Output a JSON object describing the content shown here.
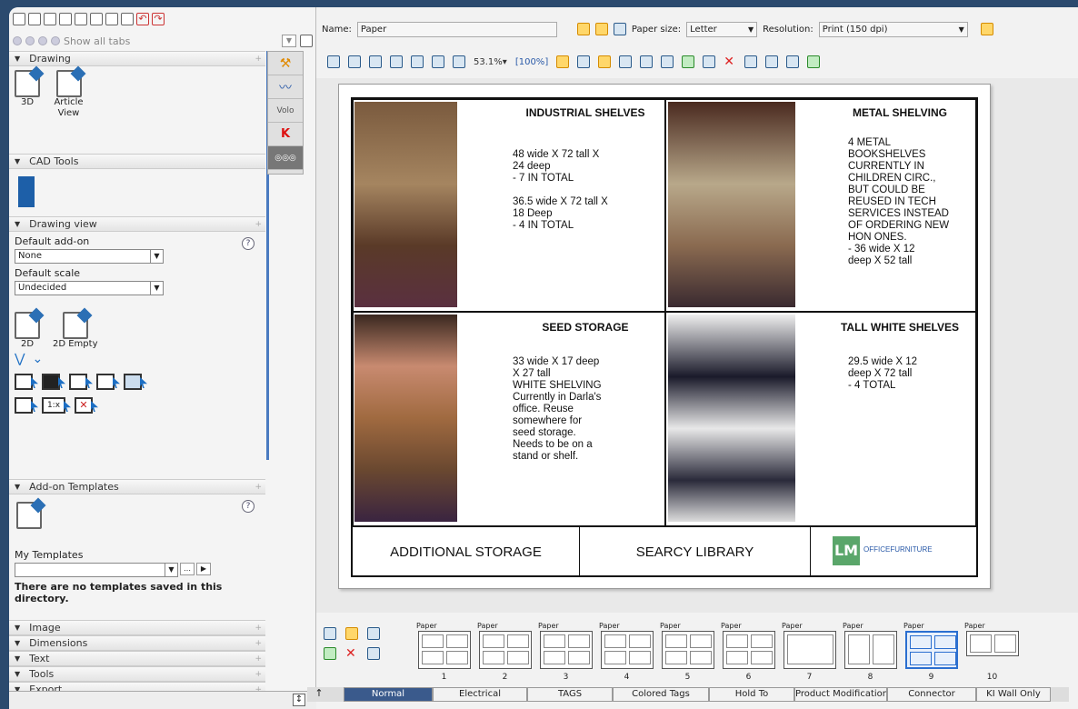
{
  "left": {
    "showtabs": "Show all tabs",
    "drawing": {
      "title": "Drawing",
      "item3d": "3D",
      "article": "Article View"
    },
    "cad": {
      "title": "CAD Tools"
    },
    "drawingview": {
      "title": "Drawing view",
      "addon_label": "Default add-on",
      "addon_value": "None",
      "scale_label": "Default scale",
      "scale_value": "Undecided",
      "btn2d": "2D",
      "btn2dempty": "2D Empty"
    },
    "addon": {
      "title": "Add-on Templates",
      "my_templates": "My Templates",
      "note": "There are no templates saved in this directory."
    },
    "sections": [
      "Image",
      "Dimensions",
      "Text",
      "Tools",
      "Export"
    ],
    "vtab_label": "Volo",
    "scale_button": "1:x"
  },
  "toolbar": {
    "name_label": "Name:",
    "name_value": "Paper",
    "paper_label": "Paper size:",
    "paper_value": "Letter",
    "res_label": "Resolution:",
    "res_value": "Print (150 dpi)",
    "zoom": "53.1%",
    "zoom100": "100%"
  },
  "sheet": {
    "c1": {
      "title": "INDUSTRIAL SHELVES",
      "body": "48 wide X 72 tall X\n24 deep\n- 7 IN TOTAL\n\n36.5 wide X 72 tall X\n18 Deep\n- 4 IN TOTAL"
    },
    "c2": {
      "title": "METAL SHELVING",
      "body": "4 METAL\nBOOKSHELVES\nCURRENTLY IN\nCHILDREN CIRC.,\nBUT COULD BE\nREUSED IN TECH\nSERVICES INSTEAD\nOF ORDERING NEW\nHON ONES.\n- 36 wide X 12\ndeep X 52 tall"
    },
    "c3": {
      "title": "SEED STORAGE",
      "body": "33 wide X 17 deep\nX 27 tall\nWHITE SHELVING\nCurrently in Darla's\noffice. Reuse\nsomewhere for\nseed storage.\nNeeds to be on a\nstand or shelf."
    },
    "c4": {
      "title": "TALL WHITE SHELVES",
      "body": "29.5 wide X 12\ndeep X 72 tall\n- 4 TOTAL"
    },
    "footer_left": "ADDITIONAL STORAGE",
    "footer_mid": "SEARCY LIBRARY",
    "logo_letters": "LM",
    "logo_text": "OFFICEFURNITURE"
  },
  "thumbs": [
    {
      "label": "Paper",
      "num": "1"
    },
    {
      "label": "Paper",
      "num": "2"
    },
    {
      "label": "Paper",
      "num": "3"
    },
    {
      "label": "Paper",
      "num": "4"
    },
    {
      "label": "Paper",
      "num": "5"
    },
    {
      "label": "Paper",
      "num": "6"
    },
    {
      "label": "Paper",
      "num": "7"
    },
    {
      "label": "Paper",
      "num": "8"
    },
    {
      "label": "Paper",
      "num": "9"
    },
    {
      "label": "Paper",
      "num": "10"
    }
  ],
  "tabs": [
    "Normal",
    "Electrical",
    "TAGS",
    "Colored Tags",
    "Hold To",
    "Product Modification",
    "Connector",
    "KI Wall Only"
  ],
  "colors": {
    "accent": "#3a5a8c",
    "selection": "#2b6fd0",
    "frame": "#2b4a6e"
  }
}
